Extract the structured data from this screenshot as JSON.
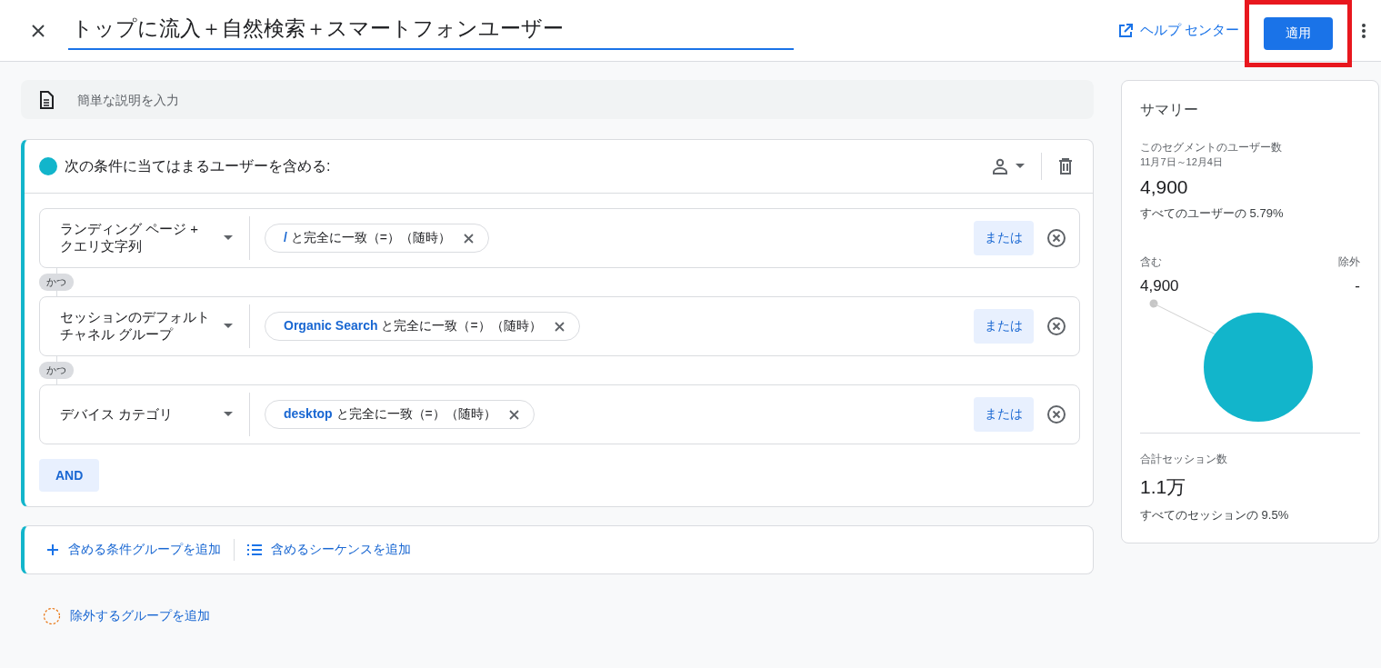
{
  "header": {
    "title": "トップに流入＋自然検索＋スマートフォンユーザー",
    "help_link": "ヘルプ センター",
    "apply_button": "適用",
    "apply_highlighted": true
  },
  "description": {
    "placeholder": "簡単な説明を入力"
  },
  "include_group": {
    "title": "次の条件に当てはまるユーザーを含める:",
    "color": "#12b5cb",
    "conditions": [
      {
        "field": "ランディング ページ + クエリ文字列",
        "chip": "**/** と完全に一致（=）（随時）",
        "or_button": "または"
      },
      {
        "field": "セッションのデフォルトチャネル グループ",
        "chip": "**Organic Search** と完全に一致（=）（随時）",
        "or_button": "または"
      },
      {
        "field": "デバイス カテゴリ",
        "chip": "**desktop** と完全に一致（=）（随時）",
        "or_button": "または"
      }
    ],
    "connectors": [
      "かつ",
      "かつ"
    ],
    "and_button": "AND"
  },
  "add_actions": [
    {
      "kind": "plus",
      "label": "含める条件グループを追加"
    },
    {
      "kind": "list",
      "label": "含めるシーケンスを追加"
    }
  ],
  "exclude_action": "除外するグループを追加",
  "summary": {
    "title": "サマリー",
    "users_label": "このセグメントのユーザー数",
    "date_range": "11月7日～12月4日",
    "users_value": "4,900",
    "users_share": "すべてのユーザーの 5.79%",
    "include_label": "含む",
    "include_value": "4,900",
    "exclude_label": "除外",
    "exclude_value": "-",
    "sessions_label": "合計セッション数",
    "sessions_value": "1.1万",
    "sessions_share": "すべてのセッションの 9.5%"
  }
}
